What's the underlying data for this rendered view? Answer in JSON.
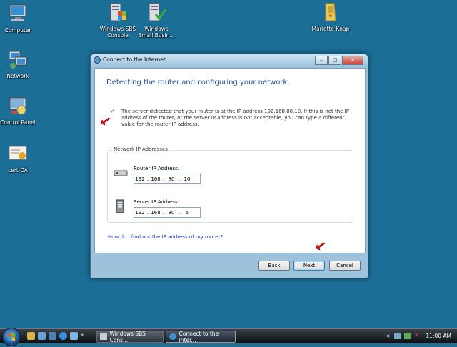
{
  "desktop": {
    "icons": [
      {
        "label": "Computer"
      },
      {
        "label": "Network"
      },
      {
        "label": "Control Panel"
      },
      {
        "label": "cert-CA"
      },
      {
        "label_line1": "Windows SBS",
        "label_line2": "Console"
      },
      {
        "label_line1": "Windows",
        "label_line2": "Small Busin..."
      },
      {
        "label": "Mariette Knap"
      }
    ]
  },
  "window": {
    "title": "Connect to the Internet",
    "controls": {
      "minimize": "–",
      "maximize": "□",
      "close": "×"
    },
    "heading": "Detecting the router and configuring your network",
    "message": "The server detected that your router is at the IP address 192.168.80.10.  If this is not the IP address of the router, or the server IP address is not acceptable, you can type a different value for the router IP address.",
    "group": {
      "legend": "Network IP Addresses",
      "router": {
        "label": "Router IP Address:",
        "octets": [
          "192",
          "168",
          "80",
          "10"
        ]
      },
      "server": {
        "label": "Server IP Address:",
        "octets": [
          "192",
          "168",
          "80",
          "5"
        ]
      },
      "separator": "."
    },
    "help_link": "How do I find out the IP address of my router?",
    "buttons": {
      "back": "Back",
      "next": "Next",
      "cancel": "Cancel"
    }
  },
  "taskbar": {
    "tasks": [
      {
        "label": "Windows SBS Cons..."
      },
      {
        "label": "Connect to the Inter..."
      }
    ],
    "clock": "11:00 AM"
  },
  "colors": {
    "desktop": "#1b6f97",
    "heading": "#1f4f9c",
    "link": "#1a37b8",
    "check": "#3aa33a",
    "arrow": "#e01b1b"
  }
}
